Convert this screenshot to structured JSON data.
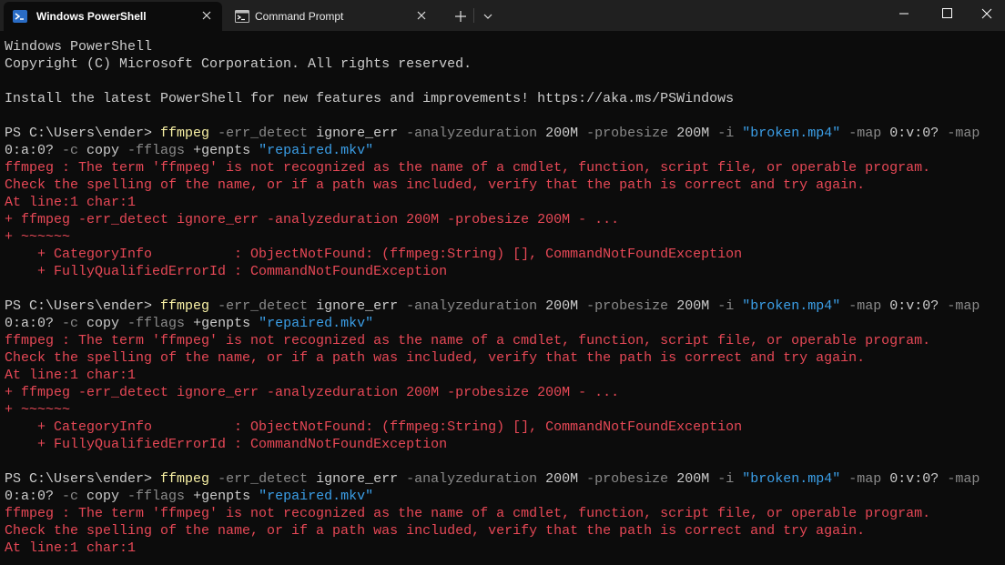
{
  "tabs": [
    {
      "label": "Windows PowerShell",
      "icon": "powershell-icon",
      "active": true
    },
    {
      "label": "Command Prompt",
      "icon": "cmd-icon",
      "active": false
    }
  ],
  "colors": {
    "background": "#0c0c0c",
    "titlebar": "#202020",
    "text": "#cccccc",
    "command": "#f9f1a5",
    "parameter": "#8a8a8a",
    "string": "#3b9fe8",
    "error": "#e74856"
  },
  "terminal": {
    "banner": [
      "Windows PowerShell",
      "Copyright (C) Microsoft Corporation. All rights reserved.",
      "",
      "Install the latest PowerShell for new features and improvements! https://aka.ms/PSWindows",
      ""
    ],
    "blocks": [
      {
        "prompt": "PS C:\\Users\\ender> ",
        "cmd_line1": [
          {
            "t": "ffmpeg",
            "c": "cmd"
          },
          {
            "t": " ",
            "c": "norm"
          },
          {
            "t": "-err_detect",
            "c": "param"
          },
          {
            "t": " ignore_err ",
            "c": "norm"
          },
          {
            "t": "-analyzeduration",
            "c": "param"
          },
          {
            "t": " 200M ",
            "c": "norm"
          },
          {
            "t": "-probesize",
            "c": "param"
          },
          {
            "t": " 200M ",
            "c": "norm"
          },
          {
            "t": "-i",
            "c": "param"
          },
          {
            "t": " ",
            "c": "norm"
          },
          {
            "t": "\"broken.mp4\"",
            "c": "str"
          },
          {
            "t": " ",
            "c": "norm"
          },
          {
            "t": "-map",
            "c": "param"
          },
          {
            "t": " 0:v:0? ",
            "c": "norm"
          },
          {
            "t": "-map",
            "c": "param"
          }
        ],
        "cmd_line2": [
          {
            "t": "0:a:0? ",
            "c": "norm"
          },
          {
            "t": "-c",
            "c": "param"
          },
          {
            "t": " copy ",
            "c": "norm"
          },
          {
            "t": "-fflags",
            "c": "param"
          },
          {
            "t": " +genpts ",
            "c": "norm"
          },
          {
            "t": "\"repaired.mkv\"",
            "c": "str"
          }
        ],
        "errors": [
          "ffmpeg : The term 'ffmpeg' is not recognized as the name of a cmdlet, function, script file, or operable program.",
          "Check the spelling of the name, or if a path was included, verify that the path is correct and try again.",
          "At line:1 char:1",
          "+ ffmpeg -err_detect ignore_err -analyzeduration 200M -probesize 200M - ...",
          "+ ~~~~~~",
          "    + CategoryInfo          : ObjectNotFound: (ffmpeg:String) [], CommandNotFoundException",
          "    + FullyQualifiedErrorId : CommandNotFoundException",
          ""
        ]
      },
      {
        "prompt": "PS C:\\Users\\ender> ",
        "cmd_line1": [
          {
            "t": "ffmpeg",
            "c": "cmd"
          },
          {
            "t": " ",
            "c": "norm"
          },
          {
            "t": "-err_detect",
            "c": "param"
          },
          {
            "t": " ignore_err ",
            "c": "norm"
          },
          {
            "t": "-analyzeduration",
            "c": "param"
          },
          {
            "t": " 200M ",
            "c": "norm"
          },
          {
            "t": "-probesize",
            "c": "param"
          },
          {
            "t": " 200M ",
            "c": "norm"
          },
          {
            "t": "-i",
            "c": "param"
          },
          {
            "t": " ",
            "c": "norm"
          },
          {
            "t": "\"broken.mp4\"",
            "c": "str"
          },
          {
            "t": " ",
            "c": "norm"
          },
          {
            "t": "-map",
            "c": "param"
          },
          {
            "t": " 0:v:0? ",
            "c": "norm"
          },
          {
            "t": "-map",
            "c": "param"
          }
        ],
        "cmd_line2": [
          {
            "t": "0:a:0? ",
            "c": "norm"
          },
          {
            "t": "-c",
            "c": "param"
          },
          {
            "t": " copy ",
            "c": "norm"
          },
          {
            "t": "-fflags",
            "c": "param"
          },
          {
            "t": " +genpts ",
            "c": "norm"
          },
          {
            "t": "\"repaired.mkv\"",
            "c": "str"
          }
        ],
        "errors": [
          "ffmpeg : The term 'ffmpeg' is not recognized as the name of a cmdlet, function, script file, or operable program.",
          "Check the spelling of the name, or if a path was included, verify that the path is correct and try again.",
          "At line:1 char:1",
          "+ ffmpeg -err_detect ignore_err -analyzeduration 200M -probesize 200M - ...",
          "+ ~~~~~~",
          "    + CategoryInfo          : ObjectNotFound: (ffmpeg:String) [], CommandNotFoundException",
          "    + FullyQualifiedErrorId : CommandNotFoundException",
          ""
        ]
      },
      {
        "prompt": "PS C:\\Users\\ender> ",
        "cmd_line1": [
          {
            "t": "ffmpeg",
            "c": "cmd"
          },
          {
            "t": " ",
            "c": "norm"
          },
          {
            "t": "-err_detect",
            "c": "param"
          },
          {
            "t": " ignore_err ",
            "c": "norm"
          },
          {
            "t": "-analyzeduration",
            "c": "param"
          },
          {
            "t": " 200M ",
            "c": "norm"
          },
          {
            "t": "-probesize",
            "c": "param"
          },
          {
            "t": " 200M ",
            "c": "norm"
          },
          {
            "t": "-i",
            "c": "param"
          },
          {
            "t": " ",
            "c": "norm"
          },
          {
            "t": "\"broken.mp4\"",
            "c": "str"
          },
          {
            "t": " ",
            "c": "norm"
          },
          {
            "t": "-map",
            "c": "param"
          },
          {
            "t": " 0:v:0? ",
            "c": "norm"
          },
          {
            "t": "-map",
            "c": "param"
          }
        ],
        "cmd_line2": [
          {
            "t": "0:a:0? ",
            "c": "norm"
          },
          {
            "t": "-c",
            "c": "param"
          },
          {
            "t": " copy ",
            "c": "norm"
          },
          {
            "t": "-fflags",
            "c": "param"
          },
          {
            "t": " +genpts ",
            "c": "norm"
          },
          {
            "t": "\"repaired.mkv\"",
            "c": "str"
          }
        ],
        "errors": [
          "ffmpeg : The term 'ffmpeg' is not recognized as the name of a cmdlet, function, script file, or operable program.",
          "Check the spelling of the name, or if a path was included, verify that the path is correct and try again.",
          "At line:1 char:1"
        ]
      }
    ]
  }
}
